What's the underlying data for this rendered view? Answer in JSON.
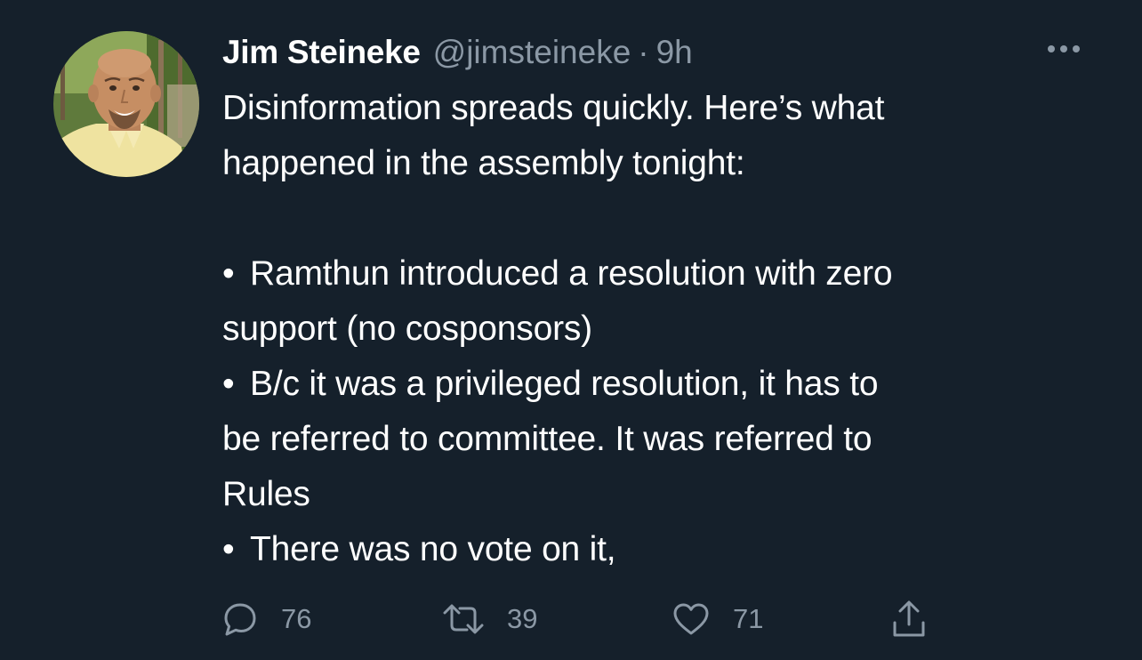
{
  "author": {
    "name": "Jim Steineke",
    "handle": "@jimsteineke",
    "separator": "·",
    "time": "9h"
  },
  "tweet": {
    "lines": [
      "Disinformation spreads quickly. Here’s what",
      "happened in the assembly tonight:",
      "",
      "Ramthun introduced a resolution with zero",
      "support (no cosponsors)",
      "B/c it was a privileged resolution, it has to",
      "be referred to committee. It was referred to",
      "Rules",
      "There was no vote on it,"
    ],
    "bullet": "•"
  },
  "actions": {
    "reply_count": "76",
    "retweet_count": "39",
    "like_count": "71",
    "reply_icon": "reply-icon",
    "retweet_icon": "retweet-icon",
    "like_icon": "heart-icon",
    "share_icon": "share-icon",
    "more_icon": "more-icon"
  },
  "colors": {
    "background": "#15202b",
    "text": "#ffffff",
    "secondary": "#8b98a5"
  }
}
